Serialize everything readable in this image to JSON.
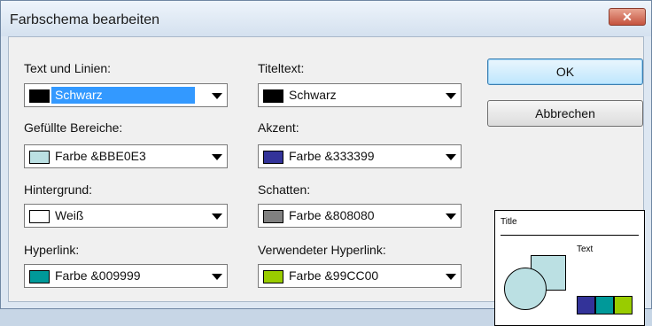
{
  "dialog": {
    "title": "Farbschema bearbeiten",
    "close_glyph": "✕"
  },
  "fields": {
    "text_lines": {
      "label": "Text und Linien:",
      "value": "Schwarz",
      "color": "#000000"
    },
    "filled_areas": {
      "label": "Gefüllte Bereiche:",
      "value": "Farbe &BBE0E3",
      "color": "#BBE0E3"
    },
    "background": {
      "label": "Hintergrund:",
      "value": "Weiß",
      "color": "#FFFFFF"
    },
    "hyperlink": {
      "label": "Hyperlink:",
      "value": "Farbe &009999",
      "color": "#009999"
    },
    "title_text": {
      "label": "Titeltext:",
      "value": "Schwarz",
      "color": "#000000"
    },
    "accent": {
      "label": "Akzent:",
      "value": "Farbe &333399",
      "color": "#333399"
    },
    "shadow": {
      "label": "Schatten:",
      "value": "Farbe &808080",
      "color": "#808080"
    },
    "visited_hyperlink": {
      "label": "Verwendeter Hyperlink:",
      "value": "Farbe &99CC00",
      "color": "#99CC00"
    }
  },
  "buttons": {
    "ok": "OK",
    "cancel": "Abbrechen"
  },
  "preview": {
    "title": "Title",
    "text": "Text"
  }
}
